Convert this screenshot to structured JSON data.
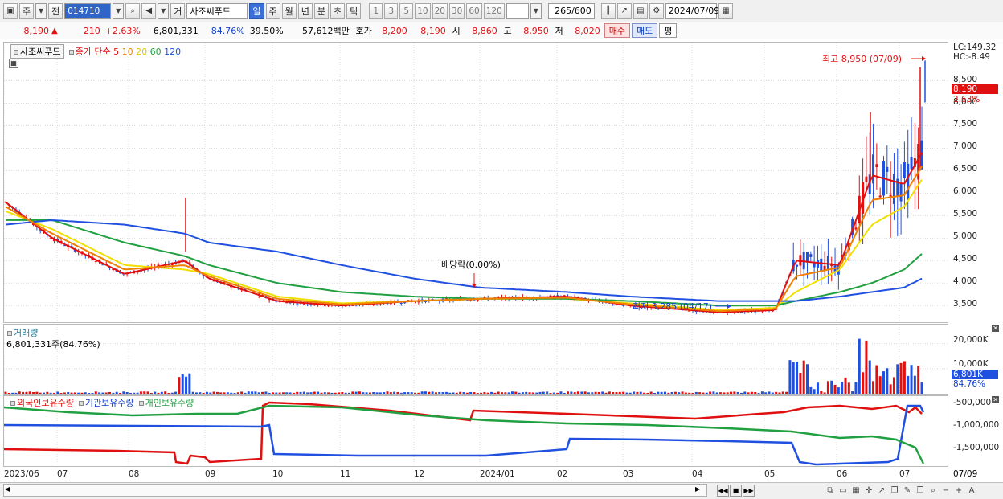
{
  "toolbar": {
    "market": "주",
    "prev": "전",
    "code": "014710",
    "name_prefix": "거",
    "name": "사조씨푸드",
    "periods": [
      "일",
      "주",
      "월",
      "년",
      "분",
      "초",
      "틱"
    ],
    "active_period": "일",
    "intervals": [
      "1",
      "3",
      "5",
      "10",
      "20",
      "30",
      "60",
      "120"
    ],
    "count": "265",
    "count_total": "/600",
    "date": "2024/07/09"
  },
  "quote": {
    "price": "8,190",
    "change_arrow": "▲",
    "change": "210",
    "change_pct": "+2.63%",
    "volume": "6,801,331",
    "vol_ratio": "84.76%",
    "turnover": "39.50%",
    "amount": "57,612백만",
    "hoga_label": "호가",
    "ask": "8,200",
    "bid": "8,190",
    "open_label": "시",
    "open": "8,860",
    "high_label": "고",
    "high": "8,950",
    "low_label": "저",
    "low": "8,020",
    "buy": "매수",
    "sell": "매도",
    "pyeong": "평"
  },
  "price_pane": {
    "name_tag": "사조씨푸드",
    "ma_label": "종가 단순",
    "ma_periods": [
      "5",
      "10",
      "20",
      "60",
      "120"
    ],
    "ma_colors": [
      "#e01010",
      "#f08000",
      "#f0e000",
      "#20a040",
      "#2050e0"
    ],
    "high_annot": "최고 8,950 (07/09)",
    "low_annot": "최저 3,285 (04/17)",
    "dividend_annot": "배당락(0.00%)",
    "lc": "LC:149.32",
    "hc": "HC:-8.49",
    "price_tag": "8,190",
    "pct_tag": "2.63%",
    "y_ticks": [
      "8,500",
      "8,000",
      "7,500",
      "7,000",
      "6,500",
      "6,000",
      "5,500",
      "5,000",
      "4,500",
      "4,000",
      "3,500"
    ]
  },
  "volume_pane": {
    "title": "거래량",
    "value": "6,801,331주(84.76%)",
    "y_ticks": [
      "20,000K",
      "10,000K"
    ],
    "tag": "6,801K",
    "pct": "84.76%"
  },
  "holdings_pane": {
    "legend": [
      "외국인보유수량",
      "기관보유수량",
      "개인보유수량"
    ],
    "colors": [
      "#e01010",
      "#2050e0",
      "#20a040"
    ],
    "y_ticks": [
      "-500,000",
      "-1,000,000",
      "-1,500,000"
    ]
  },
  "x_axis": [
    "2023/06",
    "07",
    "08",
    "09",
    "10",
    "11",
    "12",
    "2024/01",
    "02",
    "03",
    "04",
    "05",
    "06",
    "07"
  ],
  "x_axis_end": "07/09",
  "chart_data": {
    "type": "line",
    "title": "",
    "x": [
      "2023/06",
      "2023/07",
      "2023/08",
      "2023/08",
      "2023/09",
      "2023/10",
      "2023/11",
      "2023/12",
      "2024/01",
      "2024/02",
      "2024/03",
      "2024/04",
      "2024/05",
      "2024/05",
      "2024/06",
      "2024/06",
      "2024/07",
      "2024/07/09"
    ],
    "series": [
      {
        "name": "5",
        "values": [
          5800,
          5000,
          4200,
          4500,
          4100,
          3600,
          3500,
          3600,
          3650,
          3700,
          3500,
          3350,
          3400,
          4500,
          4400,
          6400,
          6200,
          6900
        ]
      },
      {
        "name": "20",
        "values": [
          5600,
          5200,
          4400,
          4300,
          4200,
          3700,
          3550,
          3600,
          3650,
          3650,
          3550,
          3400,
          3450,
          3800,
          4300,
          5300,
          5700,
          6300
        ]
      },
      {
        "name": "60",
        "values": [
          5400,
          5400,
          4900,
          4600,
          4400,
          4000,
          3800,
          3700,
          3650,
          3650,
          3600,
          3500,
          3500,
          3600,
          3800,
          4000,
          4300,
          4650
        ]
      },
      {
        "name": "120",
        "values": [
          5300,
          5400,
          5300,
          5100,
          4900,
          4700,
          4400,
          4100,
          3900,
          3800,
          3700,
          3600,
          3600,
          3600,
          3700,
          3800,
          3900,
          4100
        ]
      }
    ],
    "ylim": [
      3200,
      9100
    ],
    "high": {
      "value": 8950,
      "date": "07/09"
    },
    "low": {
      "value": 3285,
      "date": "04/17"
    }
  }
}
